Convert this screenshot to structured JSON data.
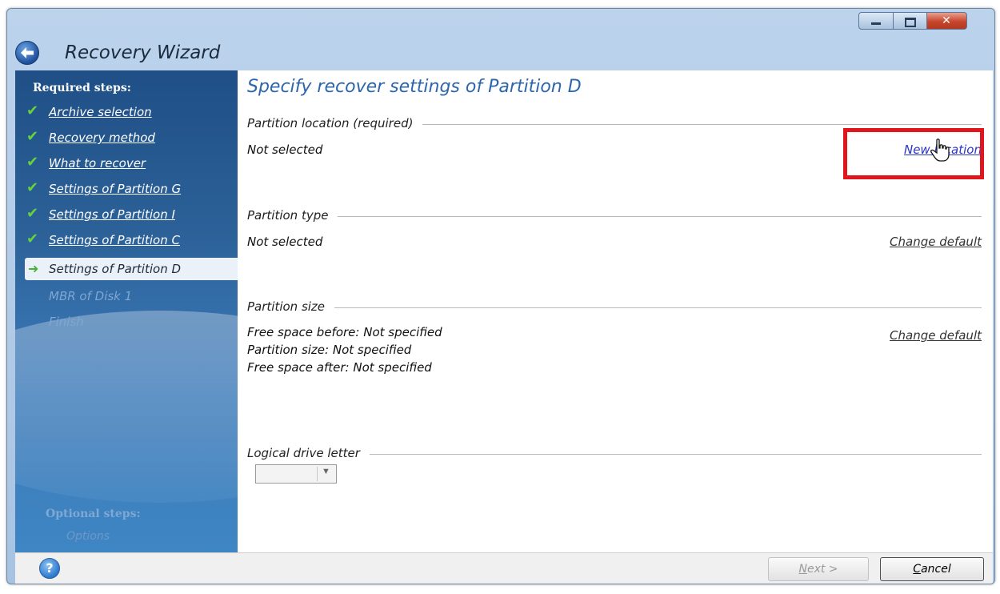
{
  "window": {
    "title": "Recovery Wizard",
    "close_glyph": "✕"
  },
  "sidebar": {
    "required_title": "Required steps:",
    "steps": [
      {
        "label": "Archive selection",
        "state": "done"
      },
      {
        "label": "Recovery method",
        "state": "done"
      },
      {
        "label": "What to recover",
        "state": "done"
      },
      {
        "label": "Settings of Partition G",
        "state": "done"
      },
      {
        "label": "Settings of Partition I",
        "state": "done"
      },
      {
        "label": "Settings of Partition C",
        "state": "done"
      },
      {
        "label": "Settings of Partition D",
        "state": "current"
      },
      {
        "label": "MBR of Disk 1",
        "state": "disabled"
      },
      {
        "label": "Finish",
        "state": "disabled"
      }
    ],
    "check_glyph": "✔",
    "current_glyph": "➜",
    "optional_title": "Optional steps:",
    "optional_item": "Options"
  },
  "main": {
    "page_title": "Specify recover settings of Partition D",
    "location": {
      "header": "Partition location (required)",
      "value": "Not selected",
      "link": "New location"
    },
    "type": {
      "header": "Partition type",
      "value": "Not selected",
      "link": "Change default"
    },
    "size": {
      "header": "Partition size",
      "free_before": "Free space before: Not specified",
      "size_line": "Partition size: Not specified",
      "free_after": "Free space after: Not specified",
      "link": "Change default"
    },
    "drive_letter": {
      "header": "Logical drive letter",
      "selected_value": "",
      "chevron": "▼"
    }
  },
  "footer": {
    "help_glyph": "?",
    "next_first": "N",
    "next_rest": "ext >",
    "cancel_first": "C",
    "cancel_rest": "ancel"
  },
  "colors": {
    "accent": "#2c66ad",
    "link": "#2b35c8",
    "highlight": "#e0161d",
    "check": "#65d23b"
  }
}
